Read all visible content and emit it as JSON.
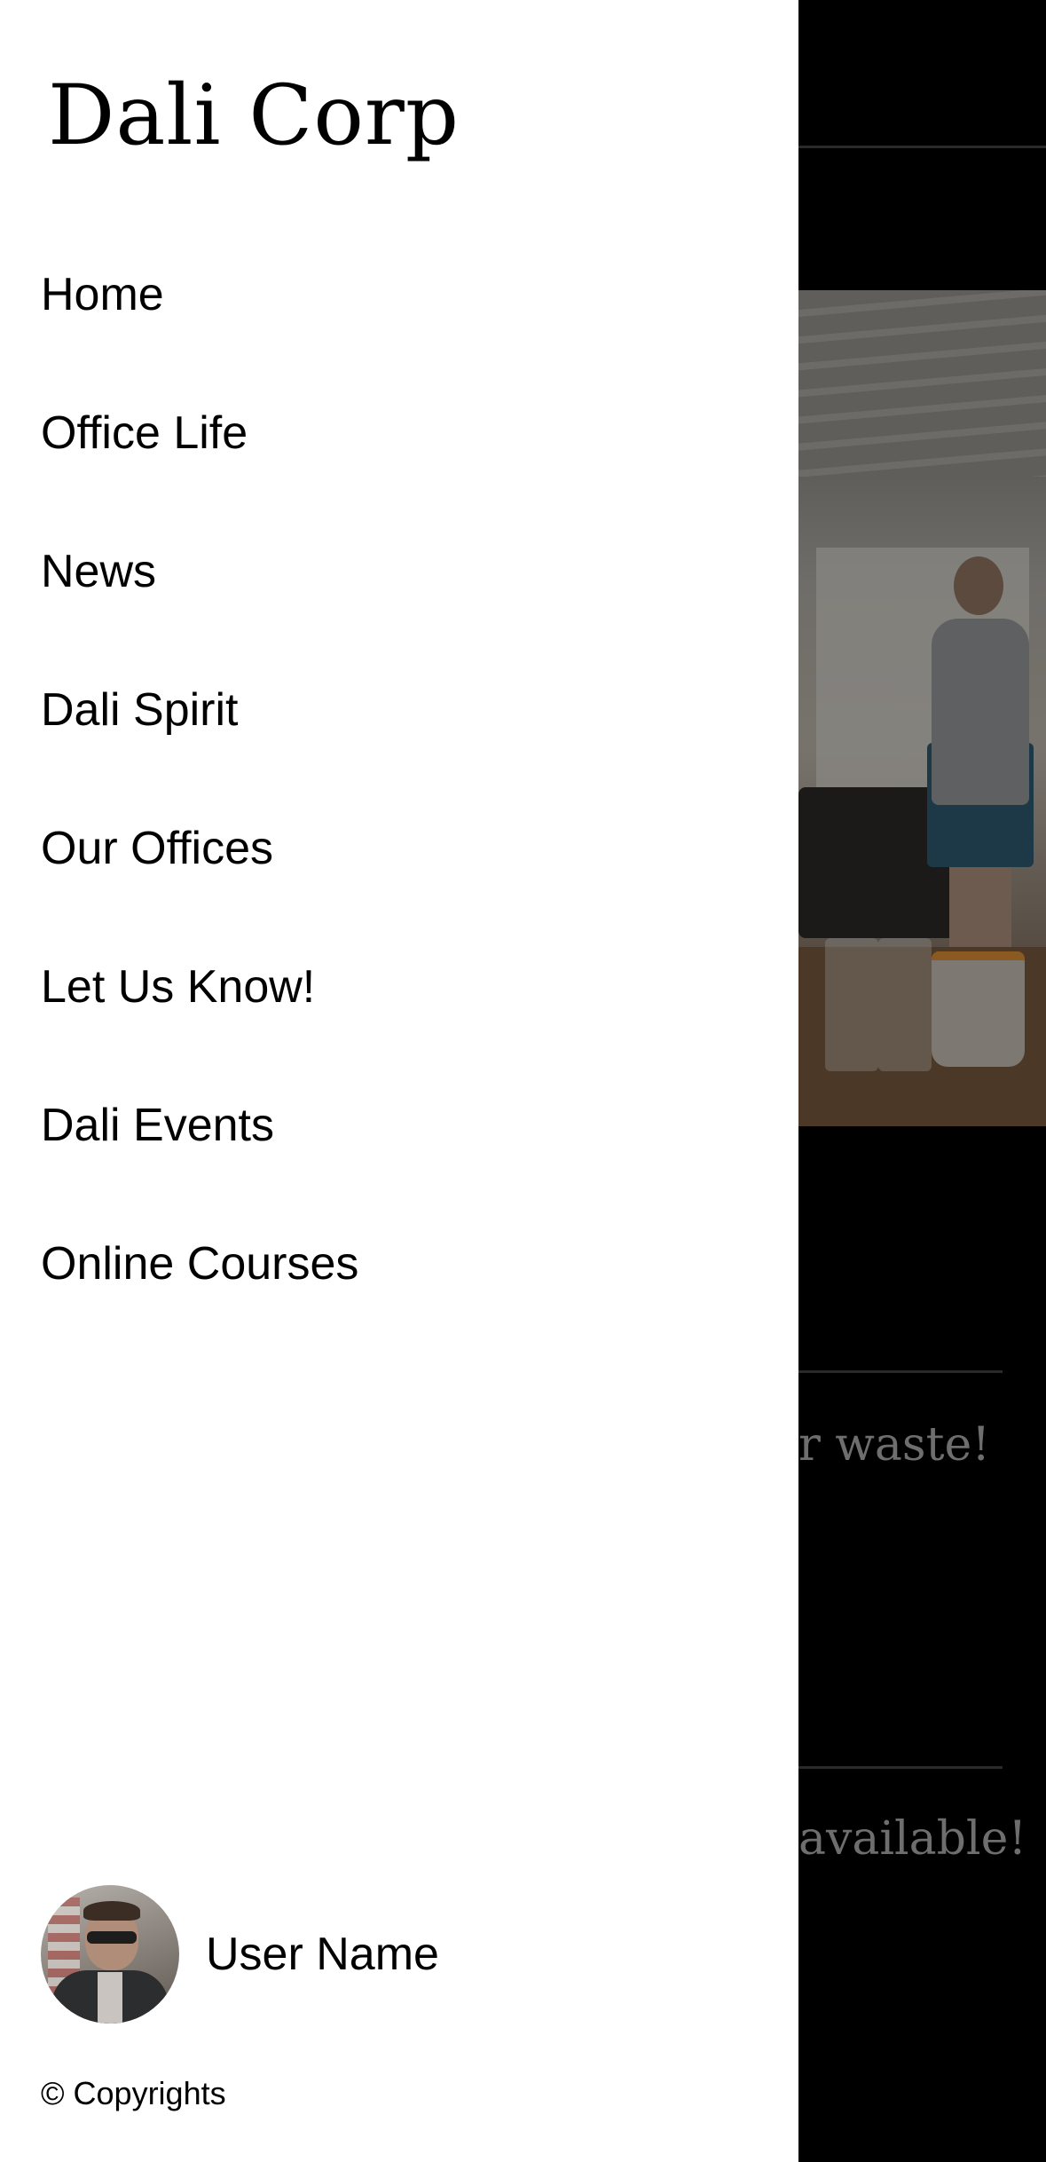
{
  "drawer": {
    "brand": "Dali Corp",
    "nav": [
      {
        "label": "Home"
      },
      {
        "label": "Office Life"
      },
      {
        "label": "News"
      },
      {
        "label": "Dali Spirit"
      },
      {
        "label": "Our Offices"
      },
      {
        "label": "Let Us Know!"
      },
      {
        "label": "Dali Events"
      },
      {
        "label": "Online Courses"
      }
    ],
    "user": {
      "name": "User Name"
    },
    "copyright": "© Copyrights"
  },
  "background": {
    "snippet_1": "r waste!",
    "snippet_2": "available!"
  },
  "colors": {
    "drawer_bg": "#ffffff",
    "overlay": "#000000",
    "text": "#000000",
    "dim_text": "#6e6e6e"
  }
}
